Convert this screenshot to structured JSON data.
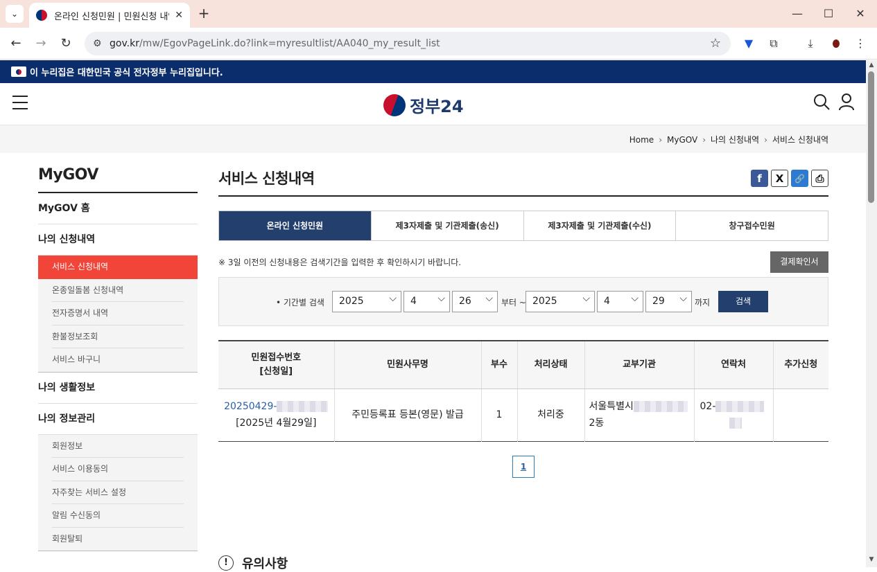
{
  "browser": {
    "tab_title": "온라인 신청민원 | 민원신청 내역",
    "close_glyph": "✕",
    "new_tab_glyph": "+",
    "dropdown_glyph": "⌄",
    "minimize_glyph": "—",
    "maximize_glyph": "☐",
    "close_window_glyph": "✕",
    "url_host": "gov.kr",
    "url_path": "/mw/EgovPageLink.do?link=myresultlist/AA040_my_result_list",
    "back_glyph": "←",
    "forward_glyph": "→",
    "reload_glyph": "↻",
    "star_glyph": "☆",
    "tune_glyph": "⚙",
    "download_glyph": "⤓",
    "more_glyph": "⋮",
    "extension_glyph": "⧉"
  },
  "banner": {
    "text": "이 누리집은 대한민국 공식 전자정부 누리집입니다."
  },
  "header": {
    "logo_text": "정부24"
  },
  "breadcrumb": [
    "Home",
    "MyGOV",
    "나의 신청내역",
    "서비스 신청내역"
  ],
  "breadcrumb_sep": "›",
  "sidebar": {
    "title": "MyGOV",
    "home": "MyGOV 홈",
    "section1": "나의 신청내역",
    "section1_items": [
      "서비스 신청내역",
      "온종일돌봄 신청내역",
      "전자증명서 내역",
      "환불정보조회",
      "서비스 바구니"
    ],
    "section2": "나의 생활정보",
    "section3": "나의 정보관리",
    "section3_items": [
      "회원정보",
      "서비스 이용동의",
      "자주찾는 서비스 설정",
      "알림 수신동의",
      "회원탈퇴"
    ]
  },
  "main": {
    "title": "서비스 신청내역",
    "share": {
      "facebook": "f",
      "x": "X",
      "link": "🔗",
      "print": "⎙"
    },
    "tabs": [
      "온라인 신청민원",
      "제3자제출 및 기관제출(송신)",
      "제3자제출 및 기관제출(수신)",
      "창구접수민원"
    ],
    "notice": "※ 3일 이전의 신청내용은 검색기간을 입력한 후 확인하시기 바랍니다.",
    "receipt_button": "결제확인서",
    "search": {
      "label": "• 기간별 검색",
      "from_year": "2025",
      "from_month": "4",
      "from_day": "26",
      "from_suffix": "부터 ~",
      "to_year": "2025",
      "to_month": "4",
      "to_day": "29",
      "to_suffix": "까지",
      "button": "검색"
    },
    "table": {
      "headers": [
        "민원접수번호",
        "[신청일]",
        "민원사무명",
        "부수",
        "처리상태",
        "교부기관",
        "연락처",
        "추가신청"
      ],
      "rows": [
        {
          "receipt_no": "20250429-",
          "date": "[2025년 4월29일]",
          "service": "주민등록표 등본(영문) 발급",
          "copies": "1",
          "status": "처리중",
          "agency_prefix": "서울특별시",
          "agency_suffix": "2동",
          "contact_prefix": "02-",
          "extra": ""
        }
      ]
    },
    "page_number": "1",
    "caution_title": "유의사항",
    "caution_icon": "!"
  },
  "scrollbar": {
    "up": "▲",
    "down": "▼"
  }
}
